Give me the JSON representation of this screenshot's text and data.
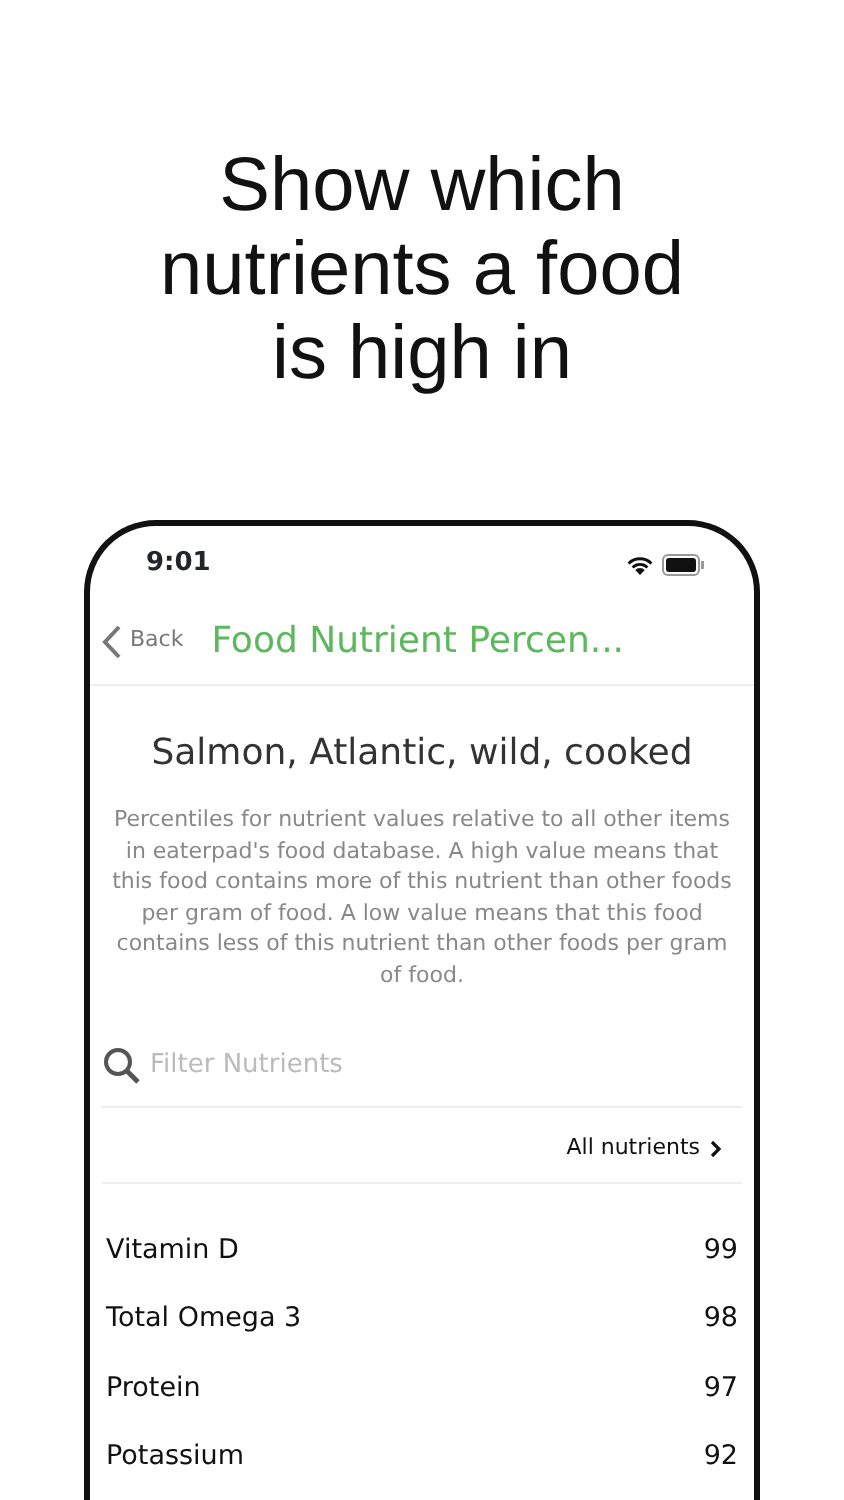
{
  "headline": "Show which nutrients a food is high in",
  "status_bar": {
    "time": "9:01"
  },
  "nav": {
    "back": "Back",
    "title": "Food Nutrient Percen..."
  },
  "food_name": "Salmon, Atlantic, wild, cooked",
  "description": "Percentiles for nutrient values relative to all other items in eaterpad's food database. A high value means that this food contains more of this nutrient than other foods per gram of food. A low value means that this food contains less of this nutrient than other foods per gram of food.",
  "search": {
    "placeholder": "Filter Nutrients"
  },
  "all_nutrients_link": "All nutrients",
  "nutrients": [
    {
      "name": "Vitamin D",
      "percentile": "99"
    },
    {
      "name": "Total Omega 3",
      "percentile": "98"
    },
    {
      "name": "Protein",
      "percentile": "97"
    },
    {
      "name": "Potassium",
      "percentile": "92"
    }
  ]
}
